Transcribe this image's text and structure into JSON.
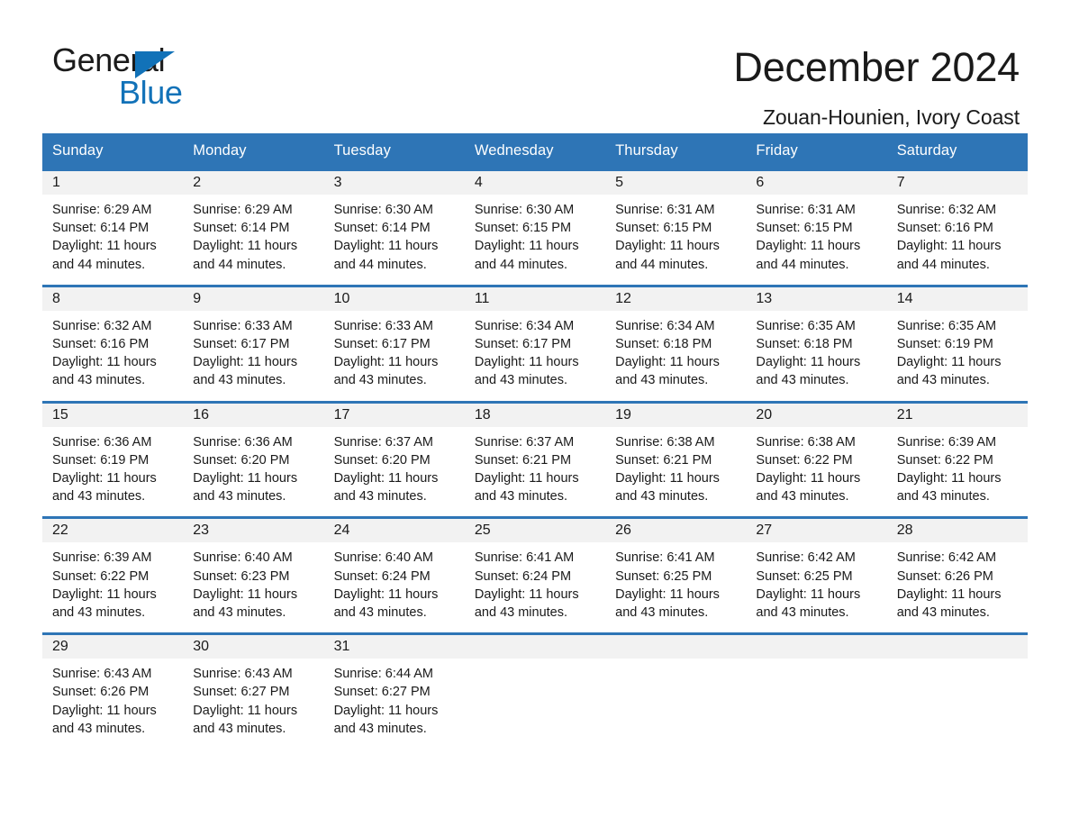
{
  "brand": {
    "name_part1": "General",
    "name_part2": "Blue",
    "accent_color": "#1272b8"
  },
  "header": {
    "title": "December 2024",
    "subtitle": "Zouan-Hounien, Ivory Coast",
    "header_bg_color": "#2e75b6",
    "row_divider_color": "#2e75b6",
    "daynum_band_color": "#f2f2f2"
  },
  "weekday_headers": [
    "Sunday",
    "Monday",
    "Tuesday",
    "Wednesday",
    "Thursday",
    "Friday",
    "Saturday"
  ],
  "labels": {
    "sunrise_prefix": "Sunrise:",
    "sunset_prefix": "Sunset:",
    "daylight_prefix": "Daylight:"
  },
  "weeks": [
    [
      {
        "day": "1",
        "sunrise": "Sunrise: 6:29 AM",
        "sunset": "Sunset: 6:14 PM",
        "daylight_l1": "Daylight: 11 hours",
        "daylight_l2": "and 44 minutes."
      },
      {
        "day": "2",
        "sunrise": "Sunrise: 6:29 AM",
        "sunset": "Sunset: 6:14 PM",
        "daylight_l1": "Daylight: 11 hours",
        "daylight_l2": "and 44 minutes."
      },
      {
        "day": "3",
        "sunrise": "Sunrise: 6:30 AM",
        "sunset": "Sunset: 6:14 PM",
        "daylight_l1": "Daylight: 11 hours",
        "daylight_l2": "and 44 minutes."
      },
      {
        "day": "4",
        "sunrise": "Sunrise: 6:30 AM",
        "sunset": "Sunset: 6:15 PM",
        "daylight_l1": "Daylight: 11 hours",
        "daylight_l2": "and 44 minutes."
      },
      {
        "day": "5",
        "sunrise": "Sunrise: 6:31 AM",
        "sunset": "Sunset: 6:15 PM",
        "daylight_l1": "Daylight: 11 hours",
        "daylight_l2": "and 44 minutes."
      },
      {
        "day": "6",
        "sunrise": "Sunrise: 6:31 AM",
        "sunset": "Sunset: 6:15 PM",
        "daylight_l1": "Daylight: 11 hours",
        "daylight_l2": "and 44 minutes."
      },
      {
        "day": "7",
        "sunrise": "Sunrise: 6:32 AM",
        "sunset": "Sunset: 6:16 PM",
        "daylight_l1": "Daylight: 11 hours",
        "daylight_l2": "and 44 minutes."
      }
    ],
    [
      {
        "day": "8",
        "sunrise": "Sunrise: 6:32 AM",
        "sunset": "Sunset: 6:16 PM",
        "daylight_l1": "Daylight: 11 hours",
        "daylight_l2": "and 43 minutes."
      },
      {
        "day": "9",
        "sunrise": "Sunrise: 6:33 AM",
        "sunset": "Sunset: 6:17 PM",
        "daylight_l1": "Daylight: 11 hours",
        "daylight_l2": "and 43 minutes."
      },
      {
        "day": "10",
        "sunrise": "Sunrise: 6:33 AM",
        "sunset": "Sunset: 6:17 PM",
        "daylight_l1": "Daylight: 11 hours",
        "daylight_l2": "and 43 minutes."
      },
      {
        "day": "11",
        "sunrise": "Sunrise: 6:34 AM",
        "sunset": "Sunset: 6:17 PM",
        "daylight_l1": "Daylight: 11 hours",
        "daylight_l2": "and 43 minutes."
      },
      {
        "day": "12",
        "sunrise": "Sunrise: 6:34 AM",
        "sunset": "Sunset: 6:18 PM",
        "daylight_l1": "Daylight: 11 hours",
        "daylight_l2": "and 43 minutes."
      },
      {
        "day": "13",
        "sunrise": "Sunrise: 6:35 AM",
        "sunset": "Sunset: 6:18 PM",
        "daylight_l1": "Daylight: 11 hours",
        "daylight_l2": "and 43 minutes."
      },
      {
        "day": "14",
        "sunrise": "Sunrise: 6:35 AM",
        "sunset": "Sunset: 6:19 PM",
        "daylight_l1": "Daylight: 11 hours",
        "daylight_l2": "and 43 minutes."
      }
    ],
    [
      {
        "day": "15",
        "sunrise": "Sunrise: 6:36 AM",
        "sunset": "Sunset: 6:19 PM",
        "daylight_l1": "Daylight: 11 hours",
        "daylight_l2": "and 43 minutes."
      },
      {
        "day": "16",
        "sunrise": "Sunrise: 6:36 AM",
        "sunset": "Sunset: 6:20 PM",
        "daylight_l1": "Daylight: 11 hours",
        "daylight_l2": "and 43 minutes."
      },
      {
        "day": "17",
        "sunrise": "Sunrise: 6:37 AM",
        "sunset": "Sunset: 6:20 PM",
        "daylight_l1": "Daylight: 11 hours",
        "daylight_l2": "and 43 minutes."
      },
      {
        "day": "18",
        "sunrise": "Sunrise: 6:37 AM",
        "sunset": "Sunset: 6:21 PM",
        "daylight_l1": "Daylight: 11 hours",
        "daylight_l2": "and 43 minutes."
      },
      {
        "day": "19",
        "sunrise": "Sunrise: 6:38 AM",
        "sunset": "Sunset: 6:21 PM",
        "daylight_l1": "Daylight: 11 hours",
        "daylight_l2": "and 43 minutes."
      },
      {
        "day": "20",
        "sunrise": "Sunrise: 6:38 AM",
        "sunset": "Sunset: 6:22 PM",
        "daylight_l1": "Daylight: 11 hours",
        "daylight_l2": "and 43 minutes."
      },
      {
        "day": "21",
        "sunrise": "Sunrise: 6:39 AM",
        "sunset": "Sunset: 6:22 PM",
        "daylight_l1": "Daylight: 11 hours",
        "daylight_l2": "and 43 minutes."
      }
    ],
    [
      {
        "day": "22",
        "sunrise": "Sunrise: 6:39 AM",
        "sunset": "Sunset: 6:22 PM",
        "daylight_l1": "Daylight: 11 hours",
        "daylight_l2": "and 43 minutes."
      },
      {
        "day": "23",
        "sunrise": "Sunrise: 6:40 AM",
        "sunset": "Sunset: 6:23 PM",
        "daylight_l1": "Daylight: 11 hours",
        "daylight_l2": "and 43 minutes."
      },
      {
        "day": "24",
        "sunrise": "Sunrise: 6:40 AM",
        "sunset": "Sunset: 6:24 PM",
        "daylight_l1": "Daylight: 11 hours",
        "daylight_l2": "and 43 minutes."
      },
      {
        "day": "25",
        "sunrise": "Sunrise: 6:41 AM",
        "sunset": "Sunset: 6:24 PM",
        "daylight_l1": "Daylight: 11 hours",
        "daylight_l2": "and 43 minutes."
      },
      {
        "day": "26",
        "sunrise": "Sunrise: 6:41 AM",
        "sunset": "Sunset: 6:25 PM",
        "daylight_l1": "Daylight: 11 hours",
        "daylight_l2": "and 43 minutes."
      },
      {
        "day": "27",
        "sunrise": "Sunrise: 6:42 AM",
        "sunset": "Sunset: 6:25 PM",
        "daylight_l1": "Daylight: 11 hours",
        "daylight_l2": "and 43 minutes."
      },
      {
        "day": "28",
        "sunrise": "Sunrise: 6:42 AM",
        "sunset": "Sunset: 6:26 PM",
        "daylight_l1": "Daylight: 11 hours",
        "daylight_l2": "and 43 minutes."
      }
    ],
    [
      {
        "day": "29",
        "sunrise": "Sunrise: 6:43 AM",
        "sunset": "Sunset: 6:26 PM",
        "daylight_l1": "Daylight: 11 hours",
        "daylight_l2": "and 43 minutes."
      },
      {
        "day": "30",
        "sunrise": "Sunrise: 6:43 AM",
        "sunset": "Sunset: 6:27 PM",
        "daylight_l1": "Daylight: 11 hours",
        "daylight_l2": "and 43 minutes."
      },
      {
        "day": "31",
        "sunrise": "Sunrise: 6:44 AM",
        "sunset": "Sunset: 6:27 PM",
        "daylight_l1": "Daylight: 11 hours",
        "daylight_l2": "and 43 minutes."
      },
      {
        "day": "",
        "sunrise": "",
        "sunset": "",
        "daylight_l1": "",
        "daylight_l2": ""
      },
      {
        "day": "",
        "sunrise": "",
        "sunset": "",
        "daylight_l1": "",
        "daylight_l2": ""
      },
      {
        "day": "",
        "sunrise": "",
        "sunset": "",
        "daylight_l1": "",
        "daylight_l2": ""
      },
      {
        "day": "",
        "sunrise": "",
        "sunset": "",
        "daylight_l1": "",
        "daylight_l2": ""
      }
    ]
  ]
}
